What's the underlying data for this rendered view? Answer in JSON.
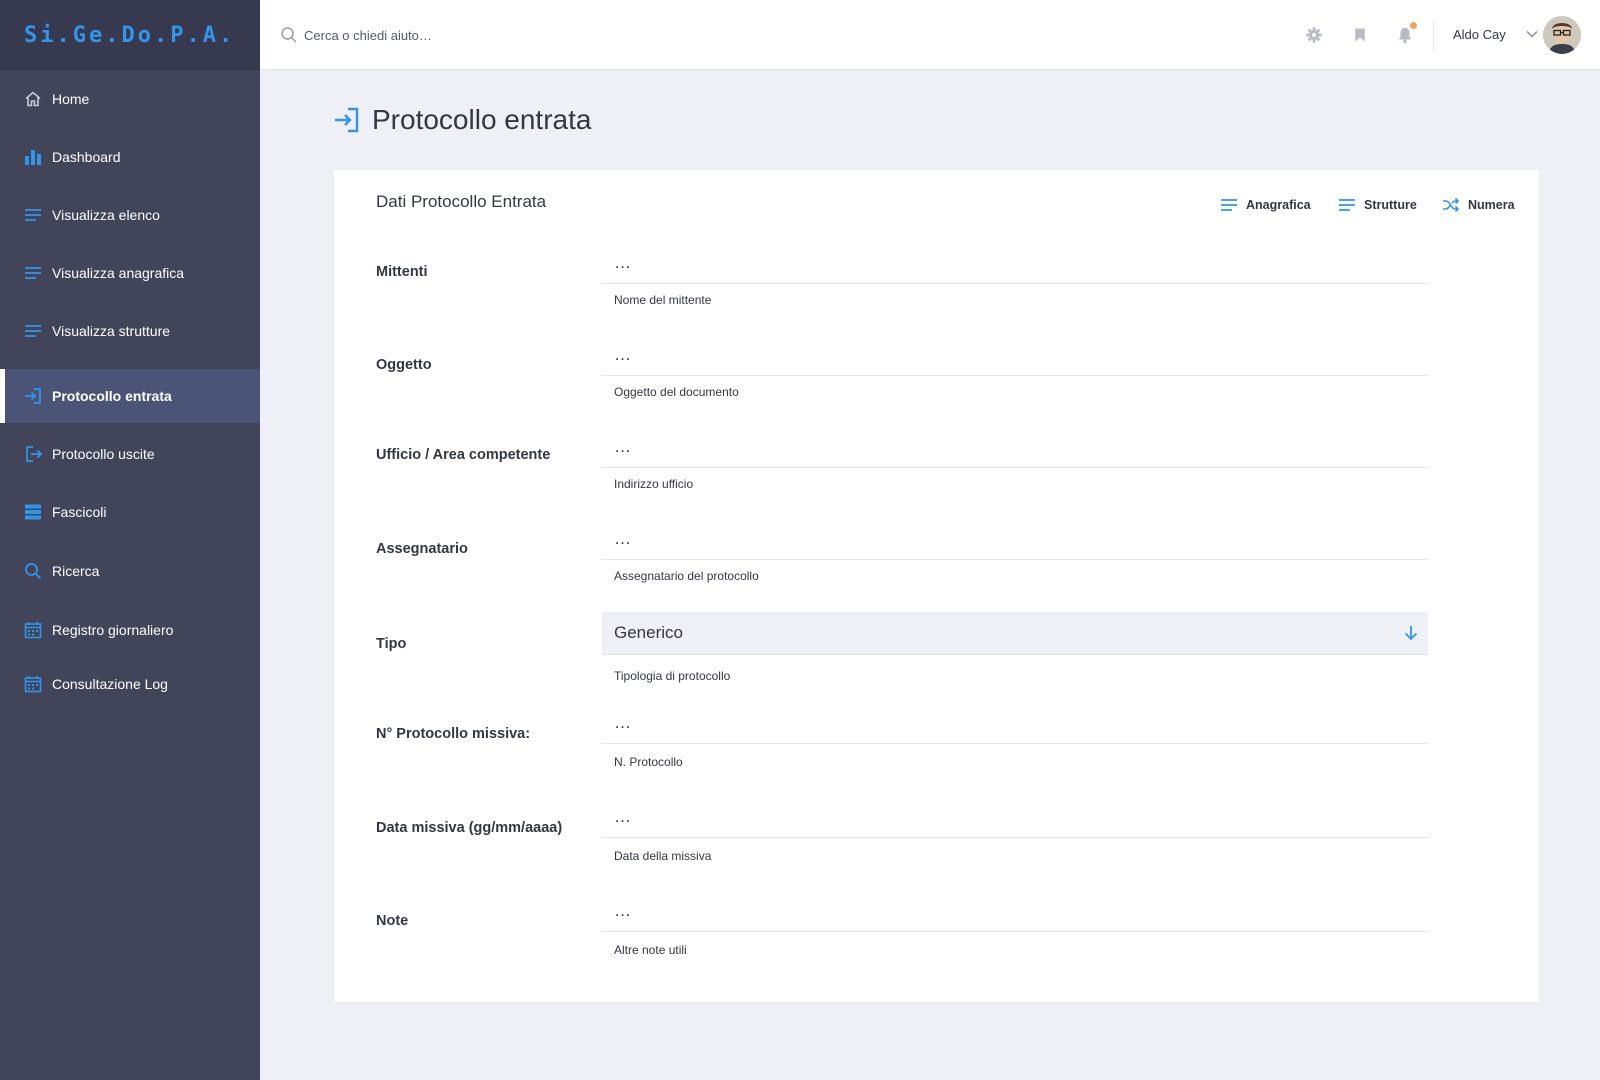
{
  "brand": {
    "name": "Si.Ge.Do.P.A."
  },
  "sidebar": {
    "items": [
      {
        "label": "Home",
        "icon": "home-icon"
      },
      {
        "label": "Dashboard",
        "icon": "bar-chart-icon"
      },
      {
        "label": "Visualizza elenco",
        "icon": "list-icon"
      },
      {
        "label": "Visualizza anagrafica",
        "icon": "list-icon"
      },
      {
        "label": "Visualizza strutture",
        "icon": "list-icon"
      },
      {
        "label": "Protocollo entrata",
        "icon": "sign-in-icon",
        "active": true
      },
      {
        "label": "Protocollo uscite",
        "icon": "sign-out-icon"
      },
      {
        "label": "Fascicoli",
        "icon": "server-icon"
      },
      {
        "label": "Ricerca",
        "icon": "search-icon"
      },
      {
        "label": "Registro giornaliero",
        "icon": "calendar-icon"
      },
      {
        "label": "Consultazione Log",
        "icon": "calendar-icon"
      }
    ]
  },
  "topbar": {
    "search_placeholder": "Cerca o chiedi aiuto…",
    "user_name": "Aldo Cay",
    "icons": [
      "gear-icon",
      "bookmark-icon",
      "bell-icon"
    ]
  },
  "page": {
    "title": "Protocollo entrata"
  },
  "card": {
    "title": "Dati Protocollo Entrata",
    "actions": [
      {
        "label": "Anagrafica",
        "icon": "list-icon"
      },
      {
        "label": "Strutture",
        "icon": "list-icon"
      },
      {
        "label": "Numera",
        "icon": "shuffle-icon"
      }
    ],
    "fields": [
      {
        "label": "Mittenti",
        "placeholder": "…",
        "help": "Nome del mittente"
      },
      {
        "label": "Oggetto",
        "placeholder": "…",
        "help": "Oggetto del documento"
      },
      {
        "label": "Ufficio / Area competente",
        "placeholder": "…",
        "help": "Indirizzo ufficio"
      },
      {
        "label": "Assegnatario",
        "placeholder": "…",
        "help": "Assegnatario del protocollo"
      },
      {
        "label": "Tipo",
        "value": "Generico",
        "help": "Tipologia di protocollo"
      },
      {
        "label": "N° Protocollo missiva:",
        "placeholder": "…",
        "help": "N. Protocollo"
      },
      {
        "label": "Data missiva (gg/mm/aaaa)",
        "placeholder": "…",
        "help": "Data della missiva"
      },
      {
        "label": "Note",
        "placeholder": "…",
        "help": "Altre note utili"
      }
    ]
  },
  "colors": {
    "accent": "#2f96ec",
    "sidebar_bg": "#42445a",
    "sidebar_active": "#4b5477",
    "page_bg": "#eff0f5"
  }
}
